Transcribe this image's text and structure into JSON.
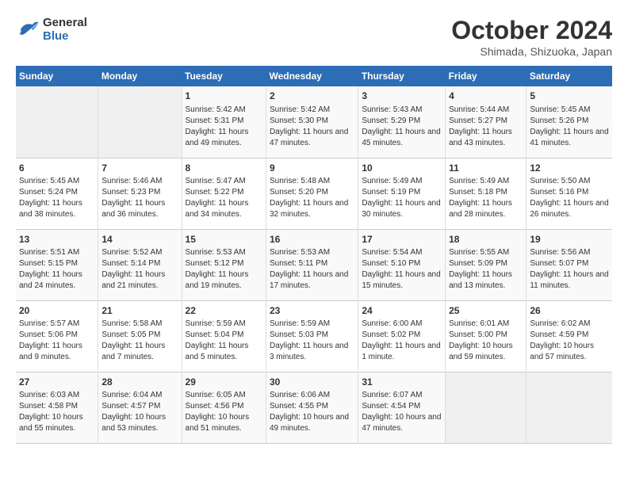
{
  "header": {
    "logo": {
      "line1": "General",
      "line2": "Blue"
    },
    "title": "October 2024",
    "subtitle": "Shimada, Shizuoka, Japan"
  },
  "weekdays": [
    "Sunday",
    "Monday",
    "Tuesday",
    "Wednesday",
    "Thursday",
    "Friday",
    "Saturday"
  ],
  "weeks": [
    [
      {
        "day": "",
        "info": ""
      },
      {
        "day": "",
        "info": ""
      },
      {
        "day": "1",
        "info": "Sunrise: 5:42 AM\nSunset: 5:31 PM\nDaylight: 11 hours and 49 minutes."
      },
      {
        "day": "2",
        "info": "Sunrise: 5:42 AM\nSunset: 5:30 PM\nDaylight: 11 hours and 47 minutes."
      },
      {
        "day": "3",
        "info": "Sunrise: 5:43 AM\nSunset: 5:29 PM\nDaylight: 11 hours and 45 minutes."
      },
      {
        "day": "4",
        "info": "Sunrise: 5:44 AM\nSunset: 5:27 PM\nDaylight: 11 hours and 43 minutes."
      },
      {
        "day": "5",
        "info": "Sunrise: 5:45 AM\nSunset: 5:26 PM\nDaylight: 11 hours and 41 minutes."
      }
    ],
    [
      {
        "day": "6",
        "info": "Sunrise: 5:45 AM\nSunset: 5:24 PM\nDaylight: 11 hours and 38 minutes."
      },
      {
        "day": "7",
        "info": "Sunrise: 5:46 AM\nSunset: 5:23 PM\nDaylight: 11 hours and 36 minutes."
      },
      {
        "day": "8",
        "info": "Sunrise: 5:47 AM\nSunset: 5:22 PM\nDaylight: 11 hours and 34 minutes."
      },
      {
        "day": "9",
        "info": "Sunrise: 5:48 AM\nSunset: 5:20 PM\nDaylight: 11 hours and 32 minutes."
      },
      {
        "day": "10",
        "info": "Sunrise: 5:49 AM\nSunset: 5:19 PM\nDaylight: 11 hours and 30 minutes."
      },
      {
        "day": "11",
        "info": "Sunrise: 5:49 AM\nSunset: 5:18 PM\nDaylight: 11 hours and 28 minutes."
      },
      {
        "day": "12",
        "info": "Sunrise: 5:50 AM\nSunset: 5:16 PM\nDaylight: 11 hours and 26 minutes."
      }
    ],
    [
      {
        "day": "13",
        "info": "Sunrise: 5:51 AM\nSunset: 5:15 PM\nDaylight: 11 hours and 24 minutes."
      },
      {
        "day": "14",
        "info": "Sunrise: 5:52 AM\nSunset: 5:14 PM\nDaylight: 11 hours and 21 minutes."
      },
      {
        "day": "15",
        "info": "Sunrise: 5:53 AM\nSunset: 5:12 PM\nDaylight: 11 hours and 19 minutes."
      },
      {
        "day": "16",
        "info": "Sunrise: 5:53 AM\nSunset: 5:11 PM\nDaylight: 11 hours and 17 minutes."
      },
      {
        "day": "17",
        "info": "Sunrise: 5:54 AM\nSunset: 5:10 PM\nDaylight: 11 hours and 15 minutes."
      },
      {
        "day": "18",
        "info": "Sunrise: 5:55 AM\nSunset: 5:09 PM\nDaylight: 11 hours and 13 minutes."
      },
      {
        "day": "19",
        "info": "Sunrise: 5:56 AM\nSunset: 5:07 PM\nDaylight: 11 hours and 11 minutes."
      }
    ],
    [
      {
        "day": "20",
        "info": "Sunrise: 5:57 AM\nSunset: 5:06 PM\nDaylight: 11 hours and 9 minutes."
      },
      {
        "day": "21",
        "info": "Sunrise: 5:58 AM\nSunset: 5:05 PM\nDaylight: 11 hours and 7 minutes."
      },
      {
        "day": "22",
        "info": "Sunrise: 5:59 AM\nSunset: 5:04 PM\nDaylight: 11 hours and 5 minutes."
      },
      {
        "day": "23",
        "info": "Sunrise: 5:59 AM\nSunset: 5:03 PM\nDaylight: 11 hours and 3 minutes."
      },
      {
        "day": "24",
        "info": "Sunrise: 6:00 AM\nSunset: 5:02 PM\nDaylight: 11 hours and 1 minute."
      },
      {
        "day": "25",
        "info": "Sunrise: 6:01 AM\nSunset: 5:00 PM\nDaylight: 10 hours and 59 minutes."
      },
      {
        "day": "26",
        "info": "Sunrise: 6:02 AM\nSunset: 4:59 PM\nDaylight: 10 hours and 57 minutes."
      }
    ],
    [
      {
        "day": "27",
        "info": "Sunrise: 6:03 AM\nSunset: 4:58 PM\nDaylight: 10 hours and 55 minutes."
      },
      {
        "day": "28",
        "info": "Sunrise: 6:04 AM\nSunset: 4:57 PM\nDaylight: 10 hours and 53 minutes."
      },
      {
        "day": "29",
        "info": "Sunrise: 6:05 AM\nSunset: 4:56 PM\nDaylight: 10 hours and 51 minutes."
      },
      {
        "day": "30",
        "info": "Sunrise: 6:06 AM\nSunset: 4:55 PM\nDaylight: 10 hours and 49 minutes."
      },
      {
        "day": "31",
        "info": "Sunrise: 6:07 AM\nSunset: 4:54 PM\nDaylight: 10 hours and 47 minutes."
      },
      {
        "day": "",
        "info": ""
      },
      {
        "day": "",
        "info": ""
      }
    ]
  ]
}
